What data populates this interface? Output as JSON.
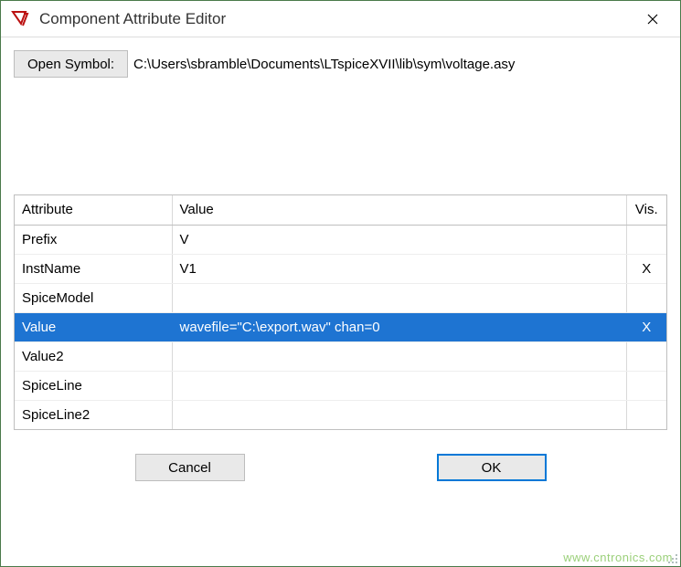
{
  "window": {
    "title": "Component Attribute Editor"
  },
  "open": {
    "button": "Open Symbol:",
    "path": "C:\\Users\\sbramble\\Documents\\LTspiceXVII\\lib\\sym\\voltage.asy"
  },
  "grid": {
    "headers": {
      "attribute": "Attribute",
      "value": "Value",
      "vis": "Vis."
    },
    "rows": [
      {
        "attr": "Prefix",
        "value": "V",
        "vis": "",
        "selected": false
      },
      {
        "attr": "InstName",
        "value": "V1",
        "vis": "X",
        "selected": false
      },
      {
        "attr": "SpiceModel",
        "value": "",
        "vis": "",
        "selected": false
      },
      {
        "attr": "Value",
        "value": "wavefile=\"C:\\export.wav\" chan=0",
        "vis": "X",
        "selected": true
      },
      {
        "attr": "Value2",
        "value": "",
        "vis": "",
        "selected": false
      },
      {
        "attr": "SpiceLine",
        "value": "",
        "vis": "",
        "selected": false
      },
      {
        "attr": "SpiceLine2",
        "value": "",
        "vis": "",
        "selected": false
      }
    ]
  },
  "buttons": {
    "cancel": "Cancel",
    "ok": "OK"
  },
  "watermark": "www.cntronics.com"
}
